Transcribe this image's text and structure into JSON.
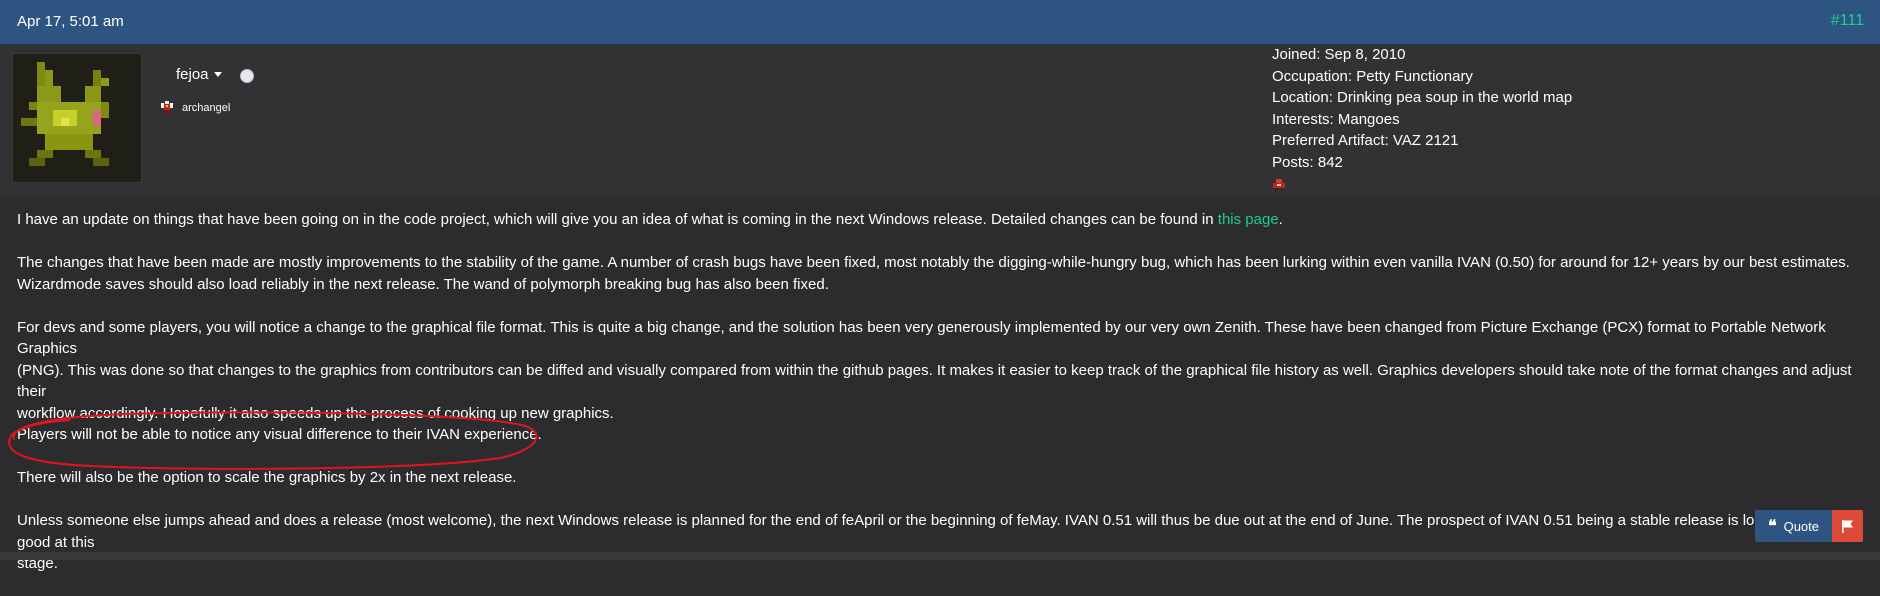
{
  "post": {
    "date": "Apr 17, 5:01 am",
    "number": "#111"
  },
  "user": {
    "name": "fejoa",
    "rank": "archangel",
    "details": [
      "Joined: Sep 8, 2010",
      "Occupation: Petty Functionary",
      "Location: Drinking pea soup in the world map",
      "Interests: Mangoes",
      "Preferred Artifact: VAZ 2121",
      "Posts: 842"
    ]
  },
  "body": {
    "p1_text": "I have an update on things that have been going on in the code project, which will give you an idea of what is coming in the next Windows release. Detailed changes can be found in ",
    "p1_link": "this page",
    "p1_end": ".",
    "p2_line1": "The changes that have been made are mostly improvements to the stability of the game. A number of crash bugs have been fixed, most notably the digging-while-hungry bug, which has been lurking within even vanilla IVAN (0.50) for around for 12+ years by our best estimates.",
    "p2_line2": "Wizardmode saves should also load reliably in the next release. The wand of polymorph breaking bug has also been fixed.",
    "p3_line1": "For devs and some players, you will notice a change to the graphical file format. This is quite a big change, and the solution has been very generously implemented by our very own Zenith. These have been changed from Picture Exchange (PCX) format to Portable Network Graphics",
    "p3_line2": "(PNG). This was done so that changes to the graphics from contributors can be diffed and visually compared from within the github pages. It makes it easier to keep track of the graphical file history as well. Graphics developers should take note of the format changes and adjust their",
    "p3_line3": "workflow accordingly. Hopefully it also speeds up the process of cooking up new graphics.",
    "p3_line4": "Players will not be able to notice any visual difference to their IVAN experience.",
    "p4": "There will also be the option to scale the graphics by 2x in the next release.",
    "p5_line1": "Unless someone else jumps ahead and does a release (most welcome), the next Windows release is planned for the end of feApril or the beginning of feMay. IVAN 0.51 will thus be due out at the end of June. The prospect of IVAN 0.51 being a stable release is looking very good at this",
    "p5_line2": "stage."
  },
  "actions": {
    "quote_label": "Quote",
    "quote_icon": "quote-icon",
    "flag_icon": "flag-icon"
  },
  "colors": {
    "header_bg": "#2e5481",
    "link": "#1ecc8c",
    "flag_button": "#dd4a3a",
    "annotation": "#e0141e"
  }
}
